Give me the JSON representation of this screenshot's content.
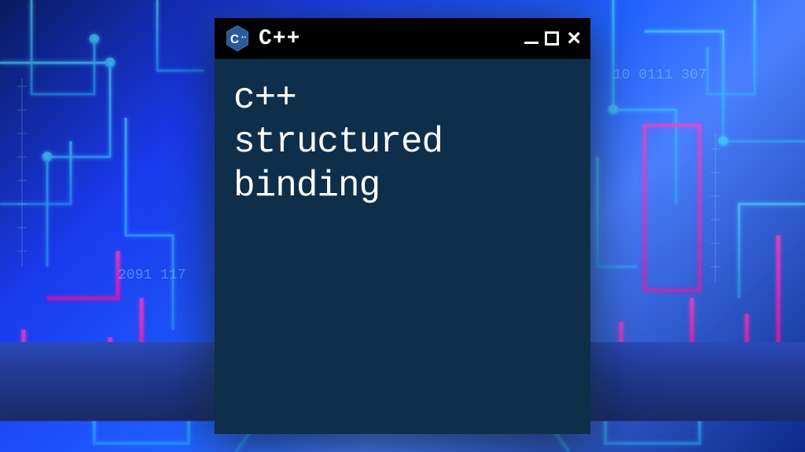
{
  "window": {
    "title": "C++",
    "icon_letter": "C",
    "icon_plus": "++"
  },
  "body": {
    "line1": "c++",
    "line2": "structured",
    "line3": "binding"
  },
  "colors": {
    "window_bg": "#0e2e4a",
    "titlebar_bg": "#000000",
    "text": "#ffffff",
    "icon_blue": "#2a5a9a"
  }
}
